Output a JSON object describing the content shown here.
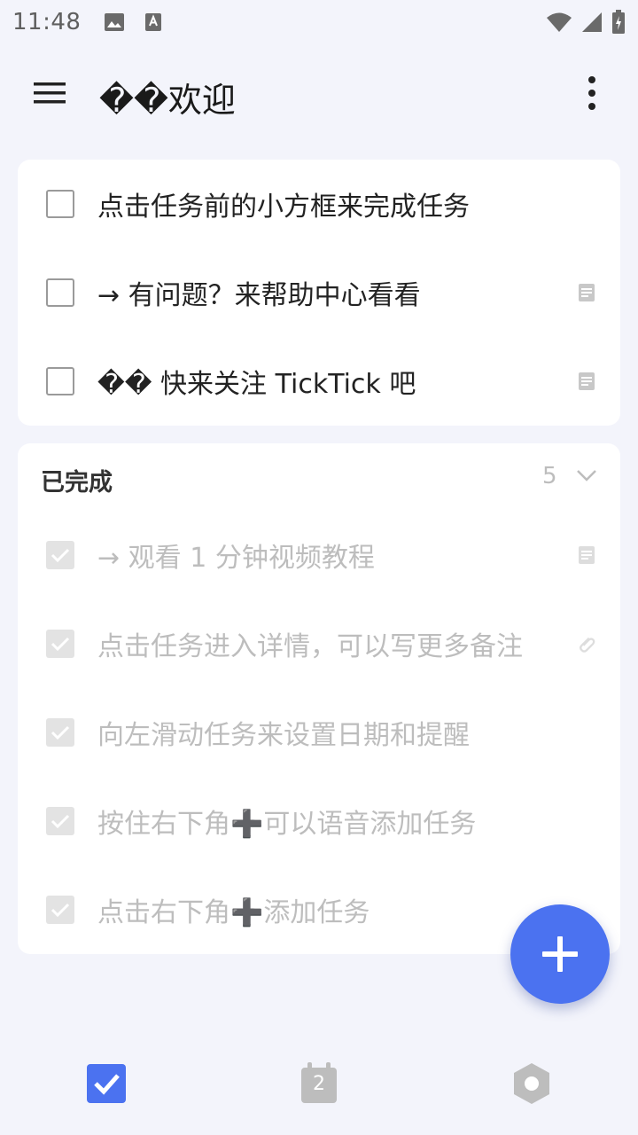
{
  "status_bar": {
    "time": "11:48"
  },
  "header": {
    "title": "��欢迎"
  },
  "tasks": [
    {
      "text": "点击任务前的小方框来完成任务",
      "has_note": false
    },
    {
      "text": "→ 有问题？来帮助中心看看",
      "has_note": true
    },
    {
      "text": "�� 快来关注 TickTick 吧",
      "has_note": true
    }
  ],
  "completed_section": {
    "title": "已完成",
    "count": "5",
    "items": [
      {
        "text": "→ 观看 1 分钟视频教程",
        "icon": "note-icon"
      },
      {
        "text": "点击任务进入详情，可以写更多备注",
        "icon": "attachment-icon"
      },
      {
        "text": "向左滑动任务来设置日期和提醒",
        "icon": ""
      },
      {
        "text": "按住右下角➕可以语音添加任务",
        "icon": ""
      },
      {
        "text": "点击右下角➕添加任务",
        "icon": ""
      }
    ]
  },
  "bottom_nav": {
    "calendar_day": "2"
  },
  "colors": {
    "accent": "#4B72F0",
    "background": "#F3F4FB",
    "done_text": "#BDBDBD"
  }
}
